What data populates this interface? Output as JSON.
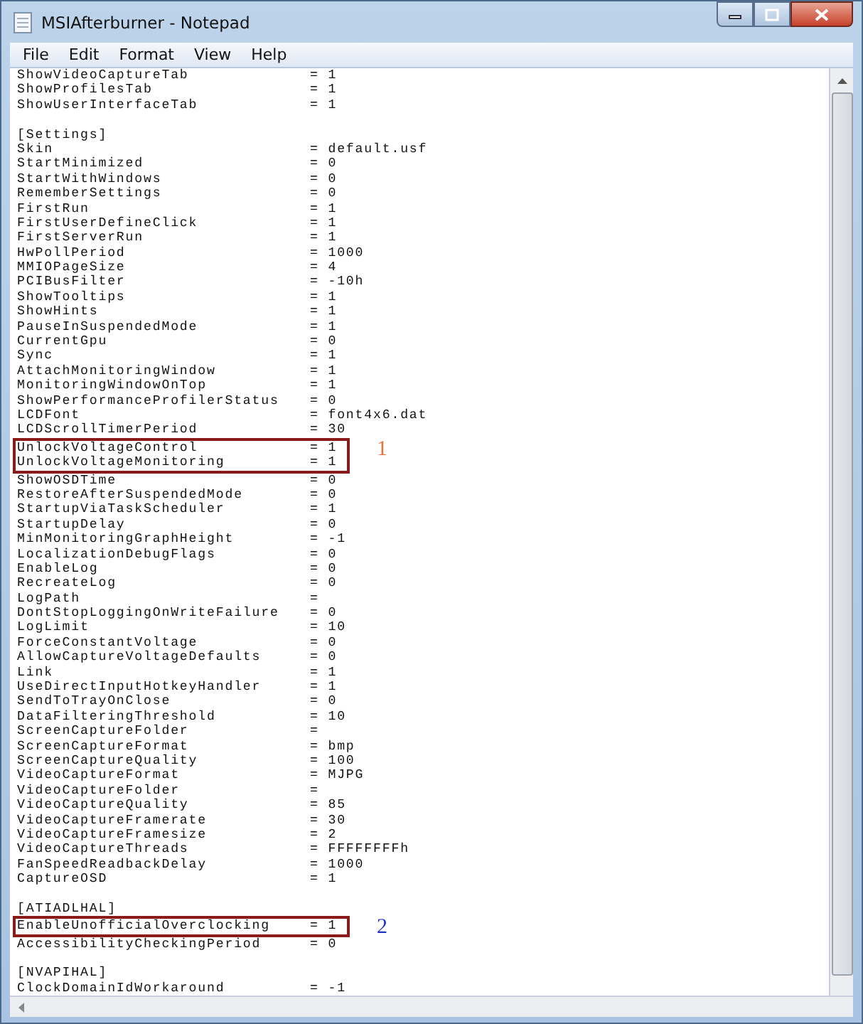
{
  "window": {
    "title": "MSIAfterburner - Notepad"
  },
  "menu": [
    "File",
    "Edit",
    "Format",
    "View",
    "Help"
  ],
  "lines": [
    {
      "kind": "entry",
      "key": "ShowVideoCaptureTab",
      "value": "= 1"
    },
    {
      "kind": "entry",
      "key": "ShowProfilesTab",
      "value": "= 1"
    },
    {
      "kind": "entry",
      "key": "ShowUserInterfaceTab",
      "value": "= 1"
    },
    {
      "kind": "blank"
    },
    {
      "kind": "section",
      "text": "[Settings]"
    },
    {
      "kind": "entry",
      "key": "Skin",
      "value": "= default.usf"
    },
    {
      "kind": "entry",
      "key": "StartMinimized",
      "value": "= 0"
    },
    {
      "kind": "entry",
      "key": "StartWithWindows",
      "value": "= 0"
    },
    {
      "kind": "entry",
      "key": "RememberSettings",
      "value": "= 0"
    },
    {
      "kind": "entry",
      "key": "FirstRun",
      "value": "= 1"
    },
    {
      "kind": "entry",
      "key": "FirstUserDefineClick",
      "value": "= 1"
    },
    {
      "kind": "entry",
      "key": "FirstServerRun",
      "value": "= 1"
    },
    {
      "kind": "entry",
      "key": "HwPollPeriod",
      "value": "= 1000"
    },
    {
      "kind": "entry",
      "key": "MMIOPageSize",
      "value": "= 4"
    },
    {
      "kind": "entry",
      "key": "PCIBusFilter",
      "value": "= -10h"
    },
    {
      "kind": "entry",
      "key": "ShowTooltips",
      "value": "= 1"
    },
    {
      "kind": "entry",
      "key": "ShowHints",
      "value": "= 1"
    },
    {
      "kind": "entry",
      "key": "PauseInSuspendedMode",
      "value": "= 1"
    },
    {
      "kind": "entry",
      "key": "CurrentGpu",
      "value": "= 0"
    },
    {
      "kind": "entry",
      "key": "Sync",
      "value": "= 1"
    },
    {
      "kind": "entry",
      "key": "AttachMonitoringWindow",
      "value": "= 1"
    },
    {
      "kind": "entry",
      "key": "MonitoringWindowOnTop",
      "value": "= 1"
    },
    {
      "kind": "entry",
      "key": "ShowPerformanceProfilerStatus",
      "value": "= 0"
    },
    {
      "kind": "entry",
      "key": "LCDFont",
      "value": "= font4x6.dat"
    },
    {
      "kind": "entry",
      "key": "LCDScrollTimerPeriod",
      "value": "= 30"
    },
    {
      "kind": "callout",
      "label": "1",
      "color": "#e8703a",
      "lines": [
        {
          "kind": "entry",
          "key": "UnlockVoltageControl",
          "value": "= 1"
        },
        {
          "kind": "entry",
          "key": "UnlockVoltageMonitoring",
          "value": "= 1"
        }
      ]
    },
    {
      "kind": "entry",
      "key": "ShowOSDTime",
      "value": "= 0"
    },
    {
      "kind": "entry",
      "key": "RestoreAfterSuspendedMode",
      "value": "= 0"
    },
    {
      "kind": "entry",
      "key": "StartupViaTaskScheduler",
      "value": "= 1"
    },
    {
      "kind": "entry",
      "key": "StartupDelay",
      "value": "= 0"
    },
    {
      "kind": "entry",
      "key": "MinMonitoringGraphHeight",
      "value": "= -1"
    },
    {
      "kind": "entry",
      "key": "LocalizationDebugFlags",
      "value": "= 0"
    },
    {
      "kind": "entry",
      "key": "EnableLog",
      "value": "= 0"
    },
    {
      "kind": "entry",
      "key": "RecreateLog",
      "value": "= 0"
    },
    {
      "kind": "entry",
      "key": "LogPath",
      "value": "="
    },
    {
      "kind": "entry",
      "key": "DontStopLoggingOnWriteFailure",
      "value": "= 0"
    },
    {
      "kind": "entry",
      "key": "LogLimit",
      "value": "= 10"
    },
    {
      "kind": "entry",
      "key": "ForceConstantVoltage",
      "value": "= 0"
    },
    {
      "kind": "entry",
      "key": "AllowCaptureVoltageDefaults",
      "value": "= 0"
    },
    {
      "kind": "entry",
      "key": "Link",
      "value": "= 1"
    },
    {
      "kind": "entry",
      "key": "UseDirectInputHotkeyHandler",
      "value": "= 1"
    },
    {
      "kind": "entry",
      "key": "SendToTrayOnClose",
      "value": "= 0"
    },
    {
      "kind": "entry",
      "key": "DataFilteringThreshold",
      "value": "= 10"
    },
    {
      "kind": "entry",
      "key": "ScreenCaptureFolder",
      "value": "="
    },
    {
      "kind": "entry",
      "key": "ScreenCaptureFormat",
      "value": "= bmp"
    },
    {
      "kind": "entry",
      "key": "ScreenCaptureQuality",
      "value": "= 100"
    },
    {
      "kind": "entry",
      "key": "VideoCaptureFormat",
      "value": "= MJPG"
    },
    {
      "kind": "entry",
      "key": "VideoCaptureFolder",
      "value": "="
    },
    {
      "kind": "entry",
      "key": "VideoCaptureQuality",
      "value": "= 85"
    },
    {
      "kind": "entry",
      "key": "VideoCaptureFramerate",
      "value": "= 30"
    },
    {
      "kind": "entry",
      "key": "VideoCaptureFramesize",
      "value": "= 2"
    },
    {
      "kind": "entry",
      "key": "VideoCaptureThreads",
      "value": "= FFFFFFFFh"
    },
    {
      "kind": "entry",
      "key": "FanSpeedReadbackDelay",
      "value": "= 1000"
    },
    {
      "kind": "entry",
      "key": "CaptureOSD",
      "value": "= 1"
    },
    {
      "kind": "blank"
    },
    {
      "kind": "section",
      "text": "[ATIADLHAL]"
    },
    {
      "kind": "callout",
      "label": "2",
      "color": "#2233cc",
      "lines": [
        {
          "kind": "entry",
          "key": "EnableUnofficialOverclocking",
          "value": "= 1"
        }
      ]
    },
    {
      "kind": "entry",
      "key": "AccessibilityCheckingPeriod",
      "value": "= 0"
    },
    {
      "kind": "blank"
    },
    {
      "kind": "section",
      "text": "[NVAPIHAL]"
    },
    {
      "kind": "entry",
      "key": "ClockDomainIdWorkaround",
      "value": "= -1"
    }
  ]
}
